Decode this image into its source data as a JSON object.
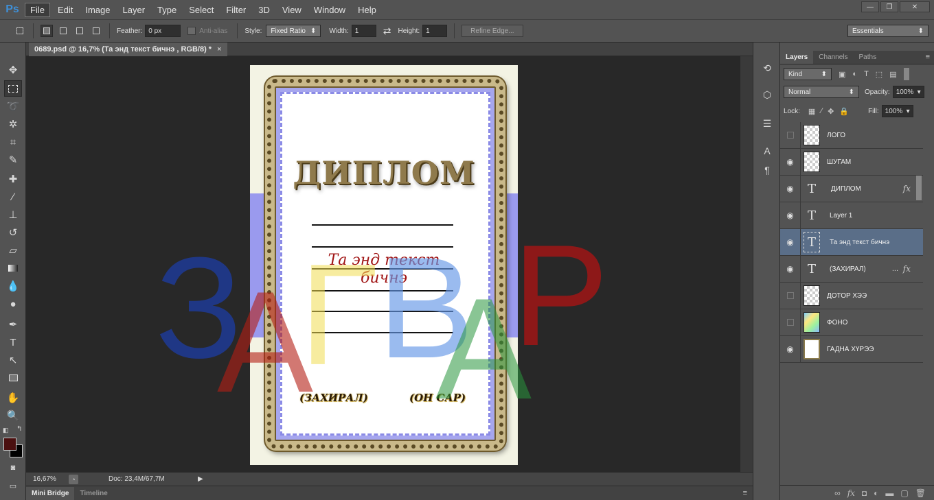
{
  "app": {
    "logo": "Ps"
  },
  "menu": [
    "File",
    "Edit",
    "Image",
    "Layer",
    "Type",
    "Select",
    "Filter",
    "3D",
    "View",
    "Window",
    "Help"
  ],
  "window_controls": {
    "minimize": "—",
    "restore": "❐",
    "close": "✕"
  },
  "options": {
    "feather_label": "Feather:",
    "feather_value": "0 px",
    "antialias_label": "Anti-alias",
    "style_label": "Style:",
    "style_value": "Fixed Ratio",
    "width_label": "Width:",
    "width_value": "1",
    "swap_icon": "⇄",
    "height_label": "Height:",
    "height_value": "1",
    "refine_edge": "Refine Edge...",
    "workspace": "Essentials"
  },
  "document": {
    "tab_title": "0689.psd @ 16,7% (Та энд текст бичнэ , RGB/8) *",
    "tab_close": "×",
    "diplom_title": "ДИПЛОМ",
    "body_text": "Та энд текст бичнэ",
    "signature_left": "(ЗАХИРАЛ)",
    "signature_right": "(ОН САР)",
    "watermark": [
      "З",
      "А",
      "Г",
      "В",
      "А",
      "Р"
    ]
  },
  "status": {
    "zoom": "16,67%",
    "doc_info": "Doc: 23,4M/67,7M"
  },
  "bottom_tabs": {
    "mini_bridge": "Mini Bridge",
    "timeline": "Timeline"
  },
  "panel": {
    "tabs": [
      "Layers",
      "Channels",
      "Paths"
    ],
    "kind_label": "Kind",
    "blend_mode": "Normal",
    "opacity_label": "Opacity:",
    "opacity_value": "100%",
    "lock_label": "Lock:",
    "fill_label": "Fill:",
    "fill_value": "100%",
    "layers": [
      {
        "name": "ЛОГО",
        "type": "image",
        "visible": false
      },
      {
        "name": "ШУГАМ",
        "type": "image",
        "visible": true
      },
      {
        "name": "ДИПЛОМ",
        "type": "text",
        "visible": true,
        "fx": "fx"
      },
      {
        "name": "Layer 1",
        "type": "text",
        "visible": true
      },
      {
        "name": "Та энд текст бичнэ",
        "type": "text",
        "visible": true,
        "selected": true
      },
      {
        "name": "(ЗАХИРАЛ)",
        "type": "text",
        "visible": true,
        "fx": "fx",
        "more": "..."
      },
      {
        "name": "ДОТОР ХЭЭ",
        "type": "image",
        "visible": false
      },
      {
        "name": "ФОНО",
        "type": "image",
        "visible": false
      },
      {
        "name": "ГАДНА ХҮРЭЭ",
        "type": "image",
        "visible": true
      }
    ]
  },
  "colors": {
    "ui_bg": "#535353",
    "canvas_bg": "#282828",
    "accent_blue": "#3f8fd6",
    "selection": "#5a6e88",
    "foreground_swatch": "#4a1010",
    "background_swatch": "#000000"
  }
}
